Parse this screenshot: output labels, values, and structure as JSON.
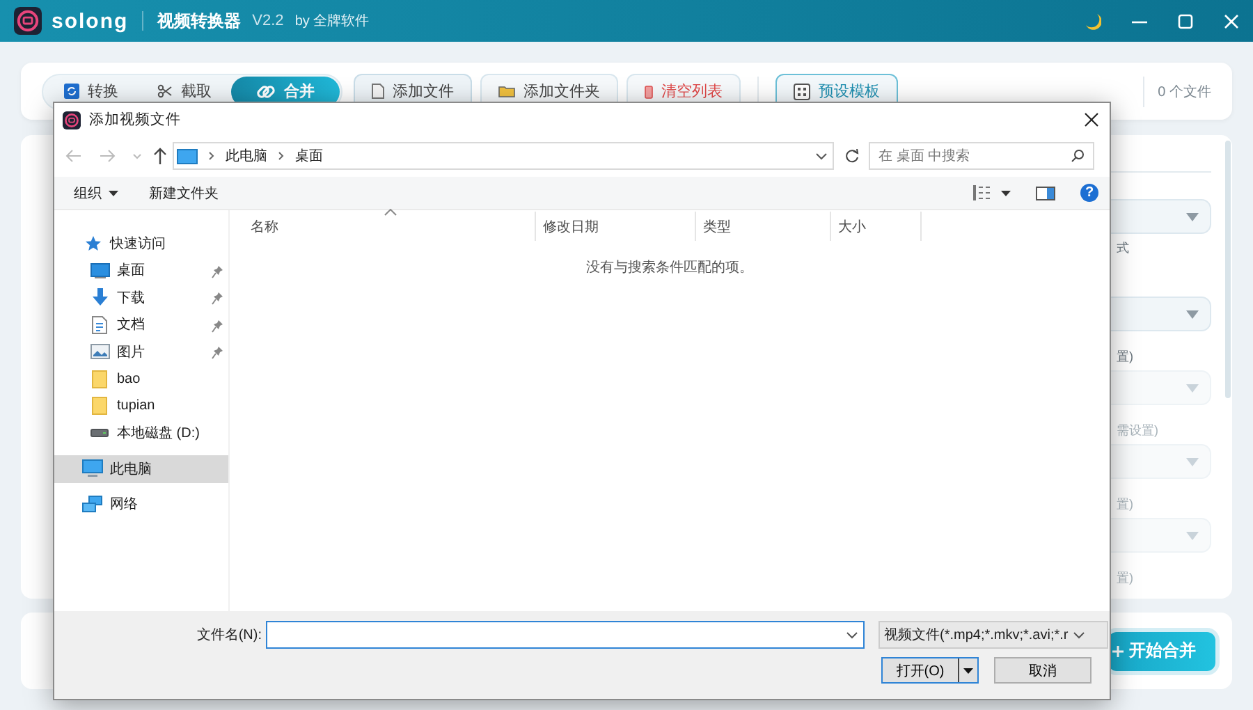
{
  "app": {
    "name": "solong",
    "title": "视频转换器",
    "version": "V2.2",
    "author": "by 全牌软件"
  },
  "modes": [
    {
      "label": "转换",
      "kind": "convert",
      "selected": false
    },
    {
      "label": "截取",
      "kind": "cut",
      "selected": false
    },
    {
      "label": "合并",
      "kind": "merge",
      "selected": true
    }
  ],
  "toolbar_buttons": [
    {
      "label": "添加文件",
      "kind": "file"
    },
    {
      "label": "添加文件夹",
      "kind": "folder"
    },
    {
      "label": "清空列表",
      "kind": "clear"
    },
    {
      "label": "预设模板",
      "kind": "template"
    }
  ],
  "file_count": "0 个文件",
  "settings_panel": [
    {
      "kind": "select",
      "disabled": false
    },
    {
      "kind": "label",
      "text": "式"
    },
    {
      "kind": "select",
      "disabled": false
    },
    {
      "kind": "label",
      "text": "置)"
    },
    {
      "kind": "select",
      "disabled": true
    },
    {
      "kind": "label",
      "text": "需设置)"
    },
    {
      "kind": "select",
      "disabled": true
    },
    {
      "kind": "label",
      "text": "置)"
    },
    {
      "kind": "select",
      "disabled": true
    },
    {
      "kind": "label",
      "text": "置)"
    }
  ],
  "start_button": "开始合并",
  "dialog": {
    "title": "添加视频文件",
    "address": [
      "此电脑",
      "桌面"
    ],
    "search": {
      "placeholder": "在 桌面 中搜索"
    },
    "commands": [
      "组织",
      "新建文件夹"
    ],
    "help": "?",
    "nav": [
      {
        "label": "快速访问",
        "kind": "star",
        "selected": false,
        "children": [
          {
            "label": "桌面",
            "kind": "desktop",
            "pinned": true,
            "selected": false
          },
          {
            "label": "下载",
            "kind": "download",
            "pinned": true,
            "selected": false
          },
          {
            "label": "文档",
            "kind": "document",
            "pinned": true,
            "selected": false
          },
          {
            "label": "图片",
            "kind": "pictures",
            "pinned": true,
            "selected": false
          },
          {
            "label": "bao",
            "kind": "folder",
            "pinned": false,
            "selected": false
          },
          {
            "label": "tupian",
            "kind": "folder",
            "pinned": false,
            "selected": false
          },
          {
            "label": "本地磁盘 (D:)",
            "kind": "drive",
            "pinned": false,
            "selected": false
          }
        ]
      },
      {
        "label": "此电脑",
        "kind": "pc",
        "selected": true
      },
      {
        "label": "网络",
        "kind": "network",
        "selected": false
      }
    ],
    "columns": [
      "名称",
      "修改日期",
      "类型",
      "大小"
    ],
    "empty_message": "没有与搜索条件匹配的项。",
    "filename_label": "文件名(N):",
    "filter": "视频文件(*.mp4;*.mkv;*.avi;*.r",
    "buttons": [
      {
        "label": "打开(O)",
        "kind": "primary"
      },
      {
        "label": "取消",
        "kind": "secondary"
      }
    ]
  }
}
